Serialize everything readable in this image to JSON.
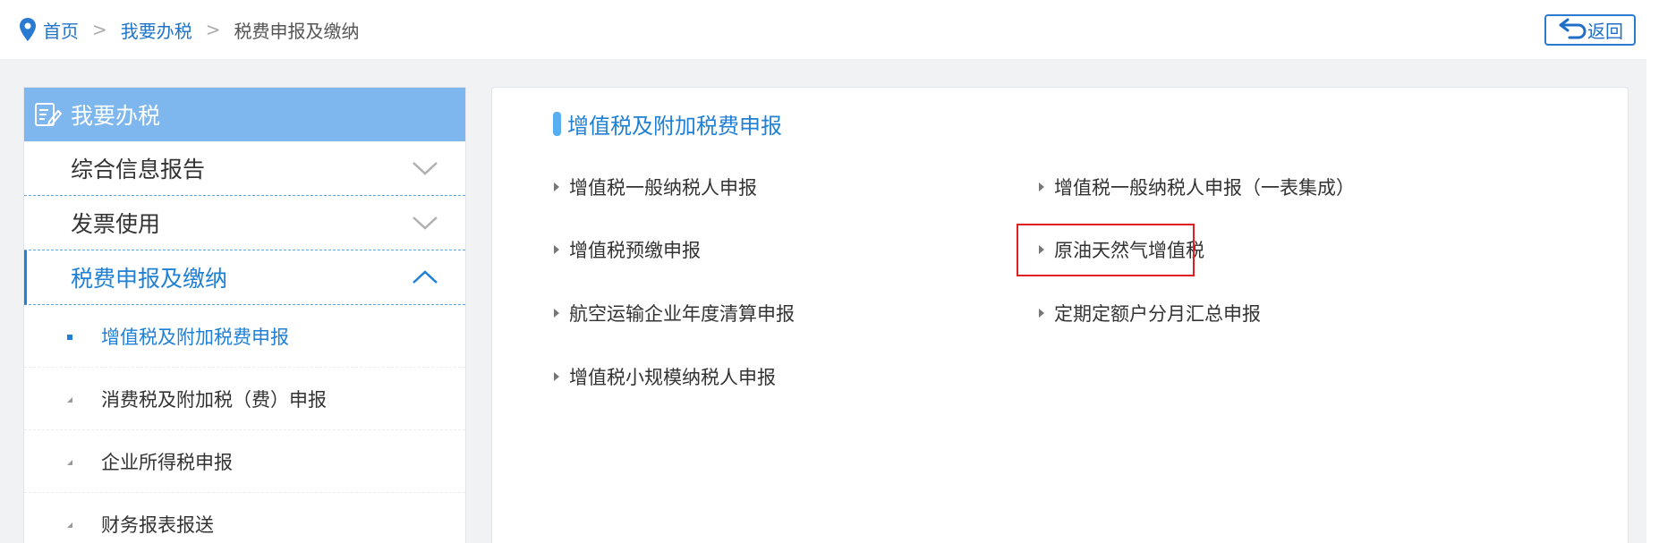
{
  "breadcrumb": {
    "home": "首页",
    "level2": "我要办税",
    "current": "税费申报及缴纳",
    "separator": ">"
  },
  "back_button": {
    "label": "返回"
  },
  "sidebar": {
    "header": "我要办税",
    "categories": [
      {
        "label": "综合信息报告",
        "expanded": false
      },
      {
        "label": "发票使用",
        "expanded": false
      },
      {
        "label": "税费申报及缴纳",
        "expanded": true
      }
    ],
    "subitems": [
      {
        "label": "增值税及附加税费申报",
        "active": true
      },
      {
        "label": "消费税及附加税（费）申报",
        "active": false
      },
      {
        "label": "企业所得税申报",
        "active": false
      },
      {
        "label": "财务报表报送",
        "active": false
      }
    ]
  },
  "main": {
    "section_title": "增值税及附加税费申报",
    "links_left": [
      "增值税一般纳税人申报",
      "增值税预缴申报",
      "航空运输企业年度清算申报",
      "增值税小规模纳税人申报"
    ],
    "links_right": [
      "增值税一般纳税人申报（一表集成）",
      "原油天然气增值税",
      "定期定额户分月汇总申报"
    ]
  },
  "colors": {
    "accent": "#1f80d6",
    "sidebar_header": "#7db7ee",
    "highlight": "#e02020"
  }
}
